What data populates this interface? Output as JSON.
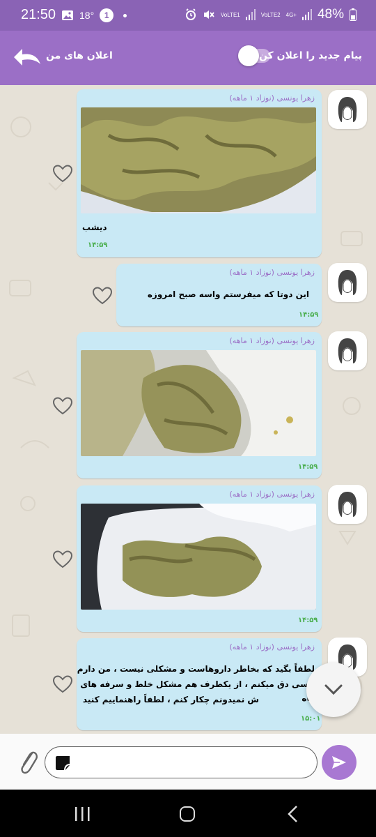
{
  "status_bar": {
    "time": "21:50",
    "temperature": "18°",
    "notification_count": "1",
    "lte1_label": "VoLTE1",
    "lte2_label": "VoLTE2",
    "network": "4G+",
    "battery": "48%"
  },
  "header": {
    "title": "اعلان های من",
    "toggle_label": "پیام جدید را اعلان کن",
    "toggle_on": false
  },
  "messages": [
    {
      "sender": "زهرا یونسی (نوزاد ۱ ماهه)",
      "type": "image",
      "caption": "دیشب",
      "time": "۱۴:۵۹"
    },
    {
      "sender": "زهرا یونسی (نوزاد ۱ ماهه)",
      "type": "text",
      "text": "این دوتا که میفرستم واسه صبح امروزه",
      "time": "۱۴:۵۹"
    },
    {
      "sender": "زهرا یونسی (نوزاد ۱ ماهه)",
      "type": "image",
      "caption": "",
      "time": "۱۴:۵۹"
    },
    {
      "sender": "زهرا یونسی (نوزاد ۱ ماهه)",
      "type": "image",
      "caption": "",
      "time": "۱۴:۵۹"
    },
    {
      "sender": "زهرا یونسی (نوزاد ۱ ماهه)",
      "type": "text",
      "lines": [
        "لطفاً بگید که بخاطر داروهاست و مشکلی نیست ، من دارم از",
        "اپسی دق میکنم ، از یکطرف هم مشکل خلط و سرفه های گاه",
        "ش نمیدونم چکار کنم ، لطفاً راهنماییم کنید"
      ],
      "time": "۱۵:۰۱"
    }
  ],
  "composer": {
    "placeholder": ""
  },
  "colors": {
    "header": "#9b6fc6",
    "bubble": "#c9e9f5",
    "sender": "#9b6fc6",
    "time": "#4caf50",
    "send": "#a878d2"
  },
  "icons": {
    "back": "back-arrow-icon",
    "heart": "heart-outline-icon",
    "attach": "paperclip-icon",
    "send": "send-icon",
    "scroll": "chevron-down-icon"
  }
}
